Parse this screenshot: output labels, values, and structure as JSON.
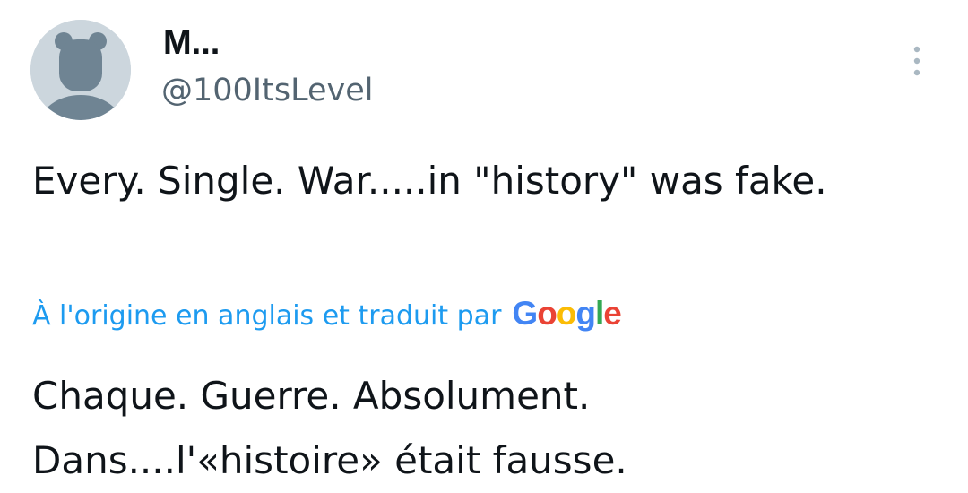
{
  "author": {
    "display_name": "M...",
    "handle": "@100ItsLevel",
    "avatar_icon": "default-avatar-icon"
  },
  "tweet": {
    "text": "Every. Single. War.....in \"history\" was fake.",
    "translation_note": "À l'origine en anglais et traduit par",
    "translation_provider": "Google",
    "translated_text": "Chaque. Guerre. Absolument. Dans....l'«histoire» était fausse."
  },
  "actions": {
    "more_icon": "more-vertical-icon"
  },
  "colors": {
    "link": "#1d9bf0",
    "secondary_text": "#536471",
    "primary_text": "#0f1419",
    "avatar_bg": "#ccd6dd",
    "avatar_fg": "#6f8493"
  }
}
